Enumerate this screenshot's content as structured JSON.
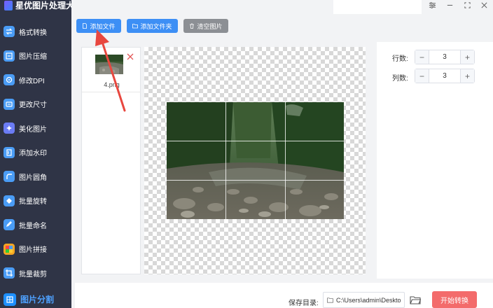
{
  "app": {
    "title": "星优图片处理大师"
  },
  "sidebar": {
    "items": [
      {
        "label": "格式转换",
        "icon": "format-convert-icon",
        "color": "#4a9cf5"
      },
      {
        "label": "图片压缩",
        "icon": "compress-icon",
        "color": "#4a9cf5"
      },
      {
        "label": "修改DPI",
        "icon": "dpi-icon",
        "color": "#4a9cf5"
      },
      {
        "label": "更改尺寸",
        "icon": "resize-icon",
        "color": "#4a9cf5"
      },
      {
        "label": "美化图片",
        "icon": "beautify-icon",
        "color": "#6b7cf5"
      },
      {
        "label": "添加水印",
        "icon": "watermark-icon",
        "color": "#4a9cf5"
      },
      {
        "label": "图片圆角",
        "icon": "rounded-corner-icon",
        "color": "#4a9cf5"
      },
      {
        "label": "批量旋转",
        "icon": "rotate-icon",
        "color": "#4a9cf5"
      },
      {
        "label": "批量命名",
        "icon": "rename-icon",
        "color": "#4a9cf5"
      },
      {
        "label": "图片拼接",
        "icon": "stitch-icon",
        "color": "#f5a623"
      },
      {
        "label": "批量裁剪",
        "icon": "crop-icon",
        "color": "#4a9cf5"
      }
    ],
    "active": {
      "label": "图片分割",
      "icon": "split-icon"
    }
  },
  "toolbar": {
    "add_file": "添加文件",
    "add_folder": "添加文件夹",
    "clear_images": "清空图片"
  },
  "files": [
    {
      "name": "4.png"
    }
  ],
  "settings": {
    "rows_label": "行数:",
    "rows_value": "3",
    "cols_label": "列数:",
    "cols_value": "3",
    "minus": "−",
    "plus": "+"
  },
  "bottom": {
    "save_label": "保存目录:",
    "save_path": "C:\\Users\\admin\\Deskto",
    "start_button": "开始转换"
  },
  "colors": {
    "sidebar_bg": "#2f3446",
    "primary": "#3d8ff5",
    "danger": "#f36b6b",
    "arrow": "#e8473f"
  }
}
